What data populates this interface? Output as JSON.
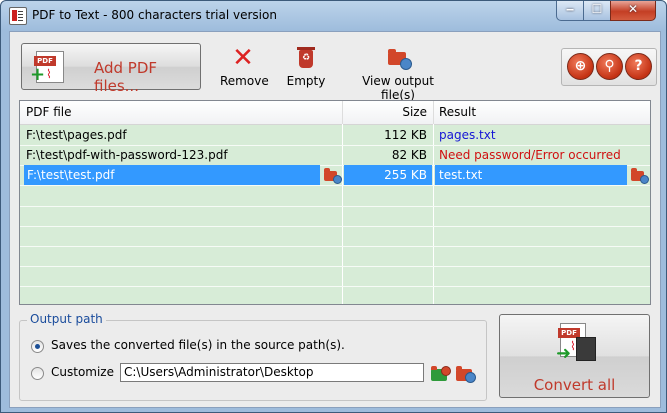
{
  "window": {
    "title": "PDF to Text - 800 characters trial version",
    "minimize_glyph": "‒",
    "maximize_glyph": "☐",
    "close_glyph": "✕"
  },
  "toolbar": {
    "add_label": "Add PDF files...",
    "add_icon_tag": "PDF",
    "remove_label": "Remove",
    "empty_label": "Empty",
    "view_label": "View output file(s)",
    "remove_icon": "red-x-icon",
    "empty_icon": "recycle-bin-icon",
    "view_icon": "folder-globe-icon"
  },
  "round_buttons": [
    {
      "icon": "globe-icon",
      "glyph": "⊕"
    },
    {
      "icon": "key-icon",
      "glyph": "⚲"
    },
    {
      "icon": "help-icon",
      "glyph": "?"
    }
  ],
  "file_list": {
    "columns": [
      "PDF file",
      "Size",
      "Result"
    ],
    "rows": [
      {
        "file": "F:\\test\\pages.pdf",
        "size": "112 KB",
        "result": "pages.txt",
        "status": "ok",
        "selected": false
      },
      {
        "file": "F:\\test\\pdf-with-password-123.pdf",
        "size": "82 KB",
        "result": "Need password/Error occurred",
        "status": "error",
        "selected": false
      },
      {
        "file": "F:\\test\\test.pdf",
        "size": "255 KB",
        "result": "test.txt",
        "status": "ok",
        "selected": true
      }
    ]
  },
  "output": {
    "group_title": "Output path",
    "option_source": "Saves the converted file(s) in the source path(s).",
    "option_custom": "Customize",
    "selected_option": "source",
    "custom_path": "C:\\Users\\Administrator\\Desktop"
  },
  "convert": {
    "label": "Convert all",
    "icon_tag": "PDF"
  },
  "colors": {
    "accent_red": "#c0392b",
    "link_blue": "#1515d6",
    "error_red": "#d01010",
    "selection": "#3399ff",
    "list_bg": "#d7ecd7"
  }
}
